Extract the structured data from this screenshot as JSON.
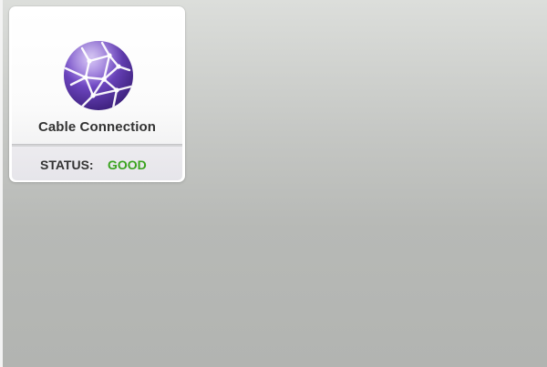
{
  "card": {
    "icon": "network-globe-icon",
    "title": "Cable Connection",
    "status_label": "STATUS:",
    "status_value": "GOOD"
  },
  "colors": {
    "status_good": "#3aa31f",
    "globe_purple": "#6a3fb8",
    "globe_dark": "#3b1f7a"
  }
}
